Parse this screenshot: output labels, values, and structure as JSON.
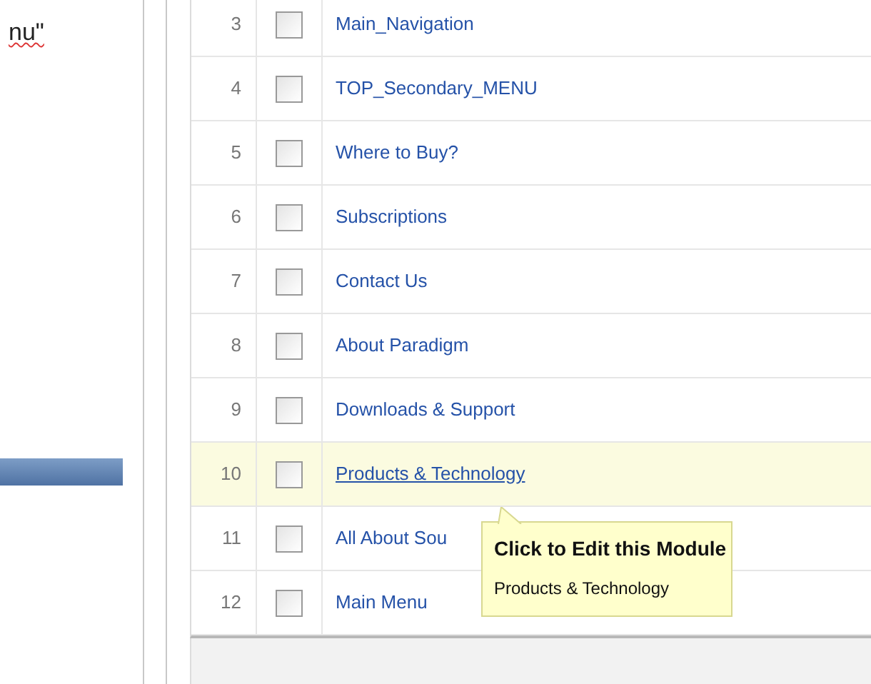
{
  "left_panel": {
    "text": "nu\"",
    "misspelled": true
  },
  "modules": [
    {
      "number": "3",
      "name": "Main_Navigation",
      "checked": false,
      "hovered": false
    },
    {
      "number": "4",
      "name": "TOP_Secondary_MENU",
      "checked": false,
      "hovered": false
    },
    {
      "number": "5",
      "name": "Where to Buy?",
      "checked": false,
      "hovered": false
    },
    {
      "number": "6",
      "name": "Subscriptions",
      "checked": false,
      "hovered": false
    },
    {
      "number": "7",
      "name": "Contact Us",
      "checked": false,
      "hovered": false
    },
    {
      "number": "8",
      "name": "About Paradigm",
      "checked": false,
      "hovered": false
    },
    {
      "number": "9",
      "name": "Downloads & Support",
      "checked": false,
      "hovered": false
    },
    {
      "number": "10",
      "name": "Products & Technology",
      "checked": false,
      "hovered": true
    },
    {
      "number": "11",
      "name": "All About Sou",
      "checked": false,
      "hovered": false
    },
    {
      "number": "12",
      "name": "Main Menu",
      "checked": false,
      "hovered": false
    }
  ],
  "tooltip": {
    "title": "Click to Edit this Module",
    "text": "Products & Technology"
  }
}
